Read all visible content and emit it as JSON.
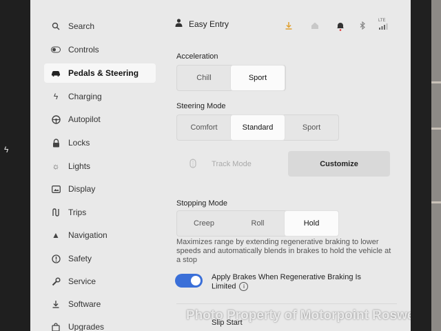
{
  "profile": {
    "name": "Easy Entry"
  },
  "status_icons": [
    "download-icon",
    "home-icon",
    "bell-icon",
    "bluetooth-icon",
    "lte-signal-icon"
  ],
  "lte_label": "LTE",
  "sidebar": {
    "items": [
      {
        "label": "Search",
        "icon": "search-icon"
      },
      {
        "label": "Controls",
        "icon": "toggle-icon"
      },
      {
        "label": "Pedals & Steering",
        "icon": "car-icon",
        "active": true
      },
      {
        "label": "Charging",
        "icon": "bolt-icon"
      },
      {
        "label": "Autopilot",
        "icon": "steering-wheel-icon"
      },
      {
        "label": "Locks",
        "icon": "lock-icon"
      },
      {
        "label": "Lights",
        "icon": "sun-icon"
      },
      {
        "label": "Display",
        "icon": "display-icon"
      },
      {
        "label": "Trips",
        "icon": "trips-icon"
      },
      {
        "label": "Navigation",
        "icon": "navigation-arrow-icon"
      },
      {
        "label": "Safety",
        "icon": "safety-icon"
      },
      {
        "label": "Service",
        "icon": "wrench-icon"
      },
      {
        "label": "Software",
        "icon": "download-icon"
      },
      {
        "label": "Upgrades",
        "icon": "bag-icon"
      }
    ]
  },
  "acceleration": {
    "label": "Acceleration",
    "options": [
      "Chill",
      "Sport"
    ],
    "selected": "Sport"
  },
  "steering": {
    "label": "Steering Mode",
    "options": [
      "Comfort",
      "Standard",
      "Sport"
    ],
    "selected": "Standard"
  },
  "track": {
    "track_label": "Track Mode",
    "customize_label": "Customize"
  },
  "stopping": {
    "label": "Stopping Mode",
    "options": [
      "Creep",
      "Roll",
      "Hold"
    ],
    "selected": "Hold",
    "description": "Maximizes range by extending regenerative braking to lower speeds and automatically blends in brakes to hold the vehicle at a stop"
  },
  "apply_brakes": {
    "label": "Apply Brakes When Regenerative Braking Is Limited",
    "enabled": true,
    "info": "i"
  },
  "slip_start": {
    "label": "Slip Start"
  },
  "watermark": "Photo Property of Motorpoint Roswell",
  "colors": {
    "toggle_on": "#3a6fd8",
    "active_bg": "#f7f7f7",
    "screen_bg": "#e9e9e9"
  }
}
